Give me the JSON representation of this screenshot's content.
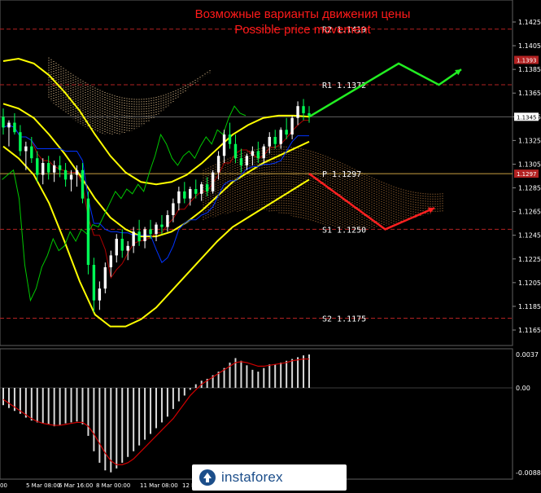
{
  "title": {
    "ru": "Возможные варианты движения цены",
    "en": "Possible price movement"
  },
  "colors": {
    "background": "#000000",
    "title": "#ff1a1a",
    "bollinger": "#ffff00",
    "bull_candle": "#ffffff",
    "bear_candle": "#00ff55",
    "kijun": "#0033ff",
    "tenkan": "#b00000",
    "chikou": "#00c800",
    "cloud_bull": "#ffd9a0",
    "cloud_bear": "#c08040",
    "arrow_up": "#22ee22",
    "arrow_down": "#ff2020",
    "level_line": "#b22222",
    "pivot_line": "#c8a040",
    "histogram": "#d8d8d8",
    "signal_line": "#d00000",
    "axis_text": "#ffffff"
  },
  "price_axis": {
    "ticks": [
      "1.1425",
      "1.1405",
      "1.1385",
      "1.1365",
      "1.1345",
      "1.1325",
      "1.1305",
      "1.1285",
      "1.1265",
      "1.1245",
      "1.1225",
      "1.1205",
      "1.1185",
      "1.1165"
    ],
    "highlight_labels": [
      {
        "value": 1.1393,
        "label": "1.1393",
        "style": "red"
      },
      {
        "value": 1.1345,
        "label": "1.1345",
        "style": "white"
      },
      {
        "value": 1.1297,
        "label": "1.1297",
        "style": "red"
      }
    ]
  },
  "levels": [
    {
      "name": "R2",
      "label": "R2  1.1419",
      "value": 1.1419
    },
    {
      "name": "R1",
      "label": "R1  1.1372",
      "value": 1.1372
    },
    {
      "name": "P",
      "label": "P  1.1297",
      "value": 1.1297
    },
    {
      "name": "S1",
      "label": "S1  1.1250",
      "value": 1.125
    },
    {
      "name": "S2",
      "label": "S2  1.1175",
      "value": 1.1175
    }
  ],
  "time_axis": [
    "00",
    "5 Mar 08:00",
    "6 Mar 16:00",
    "8 Mar 00:00",
    "11 Mar 08:00",
    "12 Ma"
  ],
  "oscillator_axis": [
    "0.0037",
    "0.00",
    "-0.00883"
  ],
  "logo_text": "instaforex",
  "chart_data": {
    "type": "candlestick",
    "title": "Возможные варианты движения цены",
    "subtitle": "Possible price movement",
    "ylim": [
      1.116,
      1.1435
    ],
    "candles": [
      [
        1.1345,
        1.1352,
        1.133,
        1.1336
      ],
      [
        1.1336,
        1.1342,
        1.132,
        1.134
      ],
      [
        1.134,
        1.1348,
        1.133,
        1.1332
      ],
      [
        1.1332,
        1.1338,
        1.1312,
        1.1316
      ],
      [
        1.1316,
        1.1324,
        1.13,
        1.132
      ],
      [
        1.132,
        1.1328,
        1.1306,
        1.131
      ],
      [
        1.131,
        1.1316,
        1.129,
        1.1296
      ],
      [
        1.1296,
        1.131,
        1.1288,
        1.1306
      ],
      [
        1.1306,
        1.1312,
        1.1292,
        1.1298
      ],
      [
        1.1298,
        1.1308,
        1.129,
        1.1304
      ],
      [
        1.1304,
        1.1312,
        1.1294,
        1.13
      ],
      [
        1.13,
        1.1306,
        1.1286,
        1.1292
      ],
      [
        1.1292,
        1.13,
        1.1282,
        1.1296
      ],
      [
        1.1296,
        1.1304,
        1.1286,
        1.13
      ],
      [
        1.13,
        1.1306,
        1.1272,
        1.1276
      ],
      [
        1.1276,
        1.1282,
        1.1212,
        1.122
      ],
      [
        1.122,
        1.1226,
        1.118,
        1.119
      ],
      [
        1.119,
        1.1206,
        1.1182,
        1.12
      ],
      [
        1.12,
        1.1222,
        1.1196,
        1.1218
      ],
      [
        1.1218,
        1.1232,
        1.121,
        1.1228
      ],
      [
        1.1228,
        1.1246,
        1.1222,
        1.1242
      ],
      [
        1.1242,
        1.125,
        1.1226,
        1.1232
      ],
      [
        1.1232,
        1.124,
        1.1224,
        1.1236
      ],
      [
        1.1236,
        1.1252,
        1.123,
        1.1248
      ],
      [
        1.1248,
        1.1258,
        1.1236,
        1.124
      ],
      [
        1.124,
        1.1252,
        1.1234,
        1.125
      ],
      [
        1.125,
        1.1258,
        1.1242,
        1.1246
      ],
      [
        1.1246,
        1.1256,
        1.124,
        1.1254
      ],
      [
        1.1254,
        1.1262,
        1.1246,
        1.1252
      ],
      [
        1.1252,
        1.1266,
        1.1248,
        1.1262
      ],
      [
        1.1262,
        1.1276,
        1.1256,
        1.1272
      ],
      [
        1.1272,
        1.1286,
        1.1266,
        1.1282
      ],
      [
        1.1282,
        1.129,
        1.1272,
        1.1276
      ],
      [
        1.1276,
        1.1286,
        1.127,
        1.1284
      ],
      [
        1.1284,
        1.1292,
        1.1276,
        1.128
      ],
      [
        1.128,
        1.129,
        1.1274,
        1.1288
      ],
      [
        1.1288,
        1.1294,
        1.1278,
        1.1282
      ],
      [
        1.1282,
        1.13,
        1.128,
        1.1298
      ],
      [
        1.1298,
        1.1316,
        1.1292,
        1.1312
      ],
      [
        1.1312,
        1.1334,
        1.1306,
        1.133
      ],
      [
        1.133,
        1.134,
        1.1318,
        1.1322
      ],
      [
        1.1322,
        1.133,
        1.1306,
        1.131
      ],
      [
        1.131,
        1.1318,
        1.1298,
        1.1304
      ],
      [
        1.1304,
        1.1314,
        1.13,
        1.1312
      ],
      [
        1.1312,
        1.132,
        1.1304,
        1.1316
      ],
      [
        1.1316,
        1.1324,
        1.1306,
        1.131
      ],
      [
        1.131,
        1.1322,
        1.1306,
        1.132
      ],
      [
        1.132,
        1.1332,
        1.1314,
        1.1328
      ],
      [
        1.1328,
        1.1334,
        1.1318,
        1.1322
      ],
      [
        1.1322,
        1.1336,
        1.1318,
        1.1334
      ],
      [
        1.1334,
        1.1344,
        1.1326,
        1.133
      ],
      [
        1.133,
        1.1346,
        1.1326,
        1.1344
      ],
      [
        1.1344,
        1.1358,
        1.1338,
        1.1354
      ],
      [
        1.1354,
        1.136,
        1.1342,
        1.1348
      ],
      [
        1.1348,
        1.1354,
        1.134,
        1.1346
      ]
    ],
    "bollinger": {
      "upper": [
        1.1392,
        1.1394,
        1.139,
        1.138,
        1.1366,
        1.135,
        1.133,
        1.1312,
        1.1298,
        1.129,
        1.1288,
        1.129,
        1.1296,
        1.1306,
        1.1318,
        1.133,
        1.1338,
        1.1344,
        1.1346,
        1.1346,
        1.1345
      ],
      "middle": [
        1.1356,
        1.1352,
        1.1344,
        1.133,
        1.1314,
        1.1296,
        1.1276,
        1.126,
        1.125,
        1.1244,
        1.1244,
        1.1248,
        1.1256,
        1.1266,
        1.1278,
        1.129,
        1.1298,
        1.1306,
        1.1312,
        1.1318,
        1.1324
      ],
      "lower": [
        1.132,
        1.131,
        1.1296,
        1.1272,
        1.124,
        1.1206,
        1.1178,
        1.1168,
        1.1168,
        1.1174,
        1.1184,
        1.1198,
        1.1212,
        1.1226,
        1.124,
        1.1252,
        1.126,
        1.1268,
        1.1276,
        1.1284,
        1.1292
      ]
    },
    "oscillator": {
      "ylim": [
        -0.00883,
        0.0037
      ],
      "histogram": [
        -0.0018,
        -0.0021,
        -0.0024,
        -0.0027,
        -0.0031,
        -0.0034,
        -0.0036,
        -0.0037,
        -0.0038,
        -0.004,
        -0.0039,
        -0.0037,
        -0.0036,
        -0.0035,
        -0.0038,
        -0.005,
        -0.0066,
        -0.0078,
        -0.0086,
        -0.0088,
        -0.0084,
        -0.0078,
        -0.0072,
        -0.0066,
        -0.006,
        -0.0054,
        -0.0048,
        -0.0042,
        -0.0036,
        -0.003,
        -0.0022,
        -0.0014,
        -0.0008,
        -0.0002,
        0.0004,
        0.0008,
        0.001,
        0.0014,
        0.0018,
        0.0022,
        0.0028,
        0.0033,
        0.003,
        0.0025,
        0.002,
        0.0018,
        0.0022,
        0.0026,
        0.0026,
        0.0028,
        0.003,
        0.0032,
        0.0034,
        0.0036,
        0.0037
      ],
      "signal": [
        -0.0012,
        -0.0016,
        -0.002,
        -0.0024,
        -0.0028,
        -0.0032,
        -0.0035,
        -0.0037,
        -0.0038,
        -0.0039,
        -0.0039,
        -0.0038,
        -0.0037,
        -0.0036,
        -0.0036,
        -0.004,
        -0.0048,
        -0.0058,
        -0.0068,
        -0.0076,
        -0.008,
        -0.008,
        -0.0078,
        -0.0074,
        -0.0068,
        -0.0062,
        -0.0056,
        -0.005,
        -0.0044,
        -0.0038,
        -0.0032,
        -0.0024,
        -0.0016,
        -0.0008,
        -0.0002,
        0.0004,
        0.0008,
        0.0012,
        0.0016,
        0.002,
        0.0024,
        0.0028,
        0.0029,
        0.0028,
        0.0026,
        0.0024,
        0.0024,
        0.0025,
        0.0026,
        0.0027,
        0.0028,
        0.003,
        0.0031,
        0.0032,
        0.0032
      ]
    },
    "scenarios": [
      {
        "direction": "up",
        "points": [
          [
            1.1345,
            0
          ],
          [
            1.139,
            1
          ],
          [
            1.1372,
            1.45
          ],
          [
            1.1385,
            1.7
          ]
        ]
      },
      {
        "direction": "down",
        "points": [
          [
            1.1297,
            0
          ],
          [
            1.125,
            0.85
          ],
          [
            1.1268,
            1.4
          ]
        ]
      }
    ]
  }
}
